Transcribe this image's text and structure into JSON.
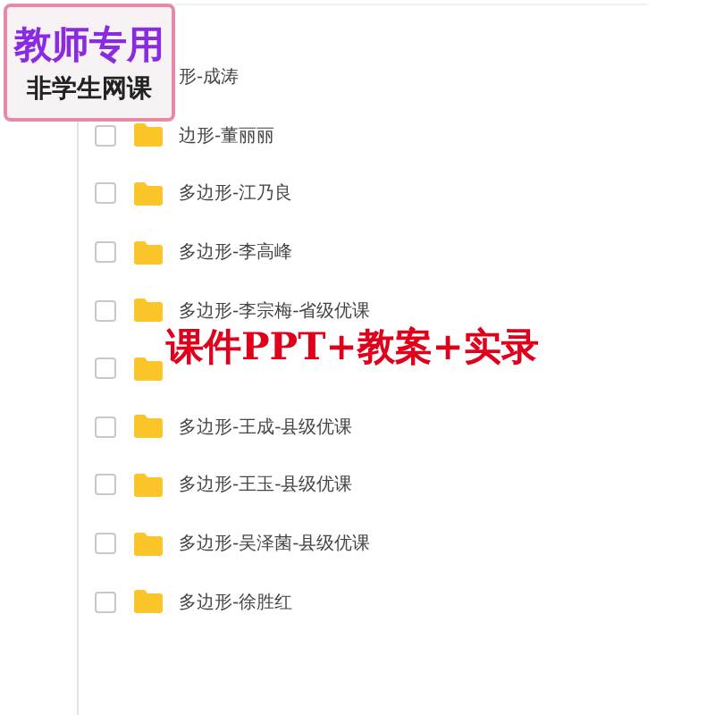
{
  "badge": {
    "title": "教师专用",
    "subtitle": "非学生网课"
  },
  "banner": "课件PPT+教案+实录",
  "files": [
    {
      "name": "形-成涛"
    },
    {
      "name": "边形-董丽丽",
      "checked": false
    },
    {
      "name": "多边形-江乃良",
      "checked": false
    },
    {
      "name": "多边形-李高峰",
      "checked": false
    },
    {
      "name": "多边形-李宗梅-省级优课",
      "checked": false
    },
    {
      "checked": false
    },
    {
      "name": "多边形-王成-县级优课",
      "checked": false
    },
    {
      "name": "多边形-王玉-县级优课",
      "checked": false
    },
    {
      "name": "多边形-吴泽菌-县级优课",
      "checked": false
    },
    {
      "name": "多边形-徐胜红",
      "checked": false
    }
  ]
}
